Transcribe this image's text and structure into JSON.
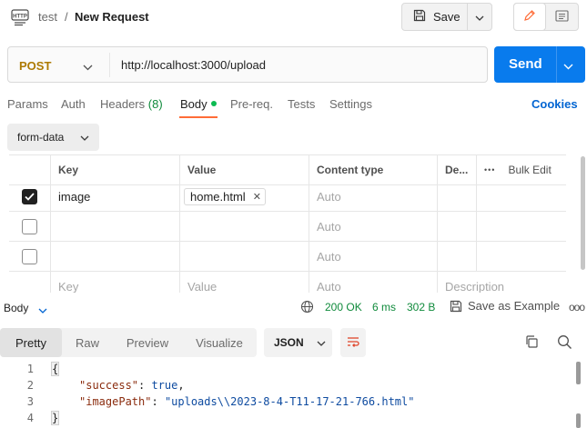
{
  "header": {
    "collection": "test",
    "separator": "/",
    "request_name": "New Request",
    "save_label": "Save"
  },
  "request": {
    "method": "POST",
    "url": "http://localhost:3000/upload",
    "send_label": "Send"
  },
  "tabs": {
    "params": "Params",
    "auth": "Auth",
    "headers": "Headers",
    "headers_count": "(8)",
    "body": "Body",
    "prereq": "Pre-req.",
    "tests": "Tests",
    "settings": "Settings",
    "cookies": "Cookies"
  },
  "body_type": "form-data",
  "table": {
    "columns": [
      "Key",
      "Value",
      "Content type",
      "De...",
      "Bulk Edit"
    ],
    "more_glyph": "•••",
    "rows": [
      {
        "checked": true,
        "key": "image",
        "value": "home.html",
        "content_type": "Auto"
      },
      {
        "checked": false,
        "key": "",
        "value": "",
        "content_type": "Auto"
      },
      {
        "checked": false,
        "key": "",
        "value": "",
        "content_type": "Auto"
      }
    ],
    "placeholder_row": {
      "key": "Key",
      "value": "Value",
      "content_type": "Auto",
      "description": "Description"
    },
    "remove_glyph": "✕"
  },
  "response": {
    "title": "Body",
    "status": "200 OK",
    "time": "6 ms",
    "size": "302 B",
    "save_example": "Save as Example",
    "more_glyph": "ooo",
    "view_tabs": [
      "Pretty",
      "Raw",
      "Preview",
      "Visualize"
    ],
    "format": "JSON",
    "code_lines": [
      {
        "num": "1",
        "text": "{"
      },
      {
        "num": "2",
        "key": "\"success\"",
        "colon": ": ",
        "value": "true",
        "trail": ","
      },
      {
        "num": "3",
        "key": "\"imagePath\"",
        "colon": ": ",
        "value": "\"uploads\\\\2023-8-4-T11-17-21-766.html\"",
        "trail": ""
      },
      {
        "num": "4",
        "text": "}"
      }
    ]
  },
  "colors": {
    "send": "#097bed",
    "method": "#ad7a03",
    "status_ok": "#0f8a3b",
    "active_tab_underline": "#ff6c37",
    "link": "#0265d2"
  },
  "icons": [
    "http-icon",
    "save-icon",
    "chevron-down-icon",
    "pencil-icon",
    "document-icon",
    "checkmark-icon",
    "close-icon",
    "globe-icon",
    "wrap-lines-icon",
    "copy-icon",
    "search-icon"
  ]
}
